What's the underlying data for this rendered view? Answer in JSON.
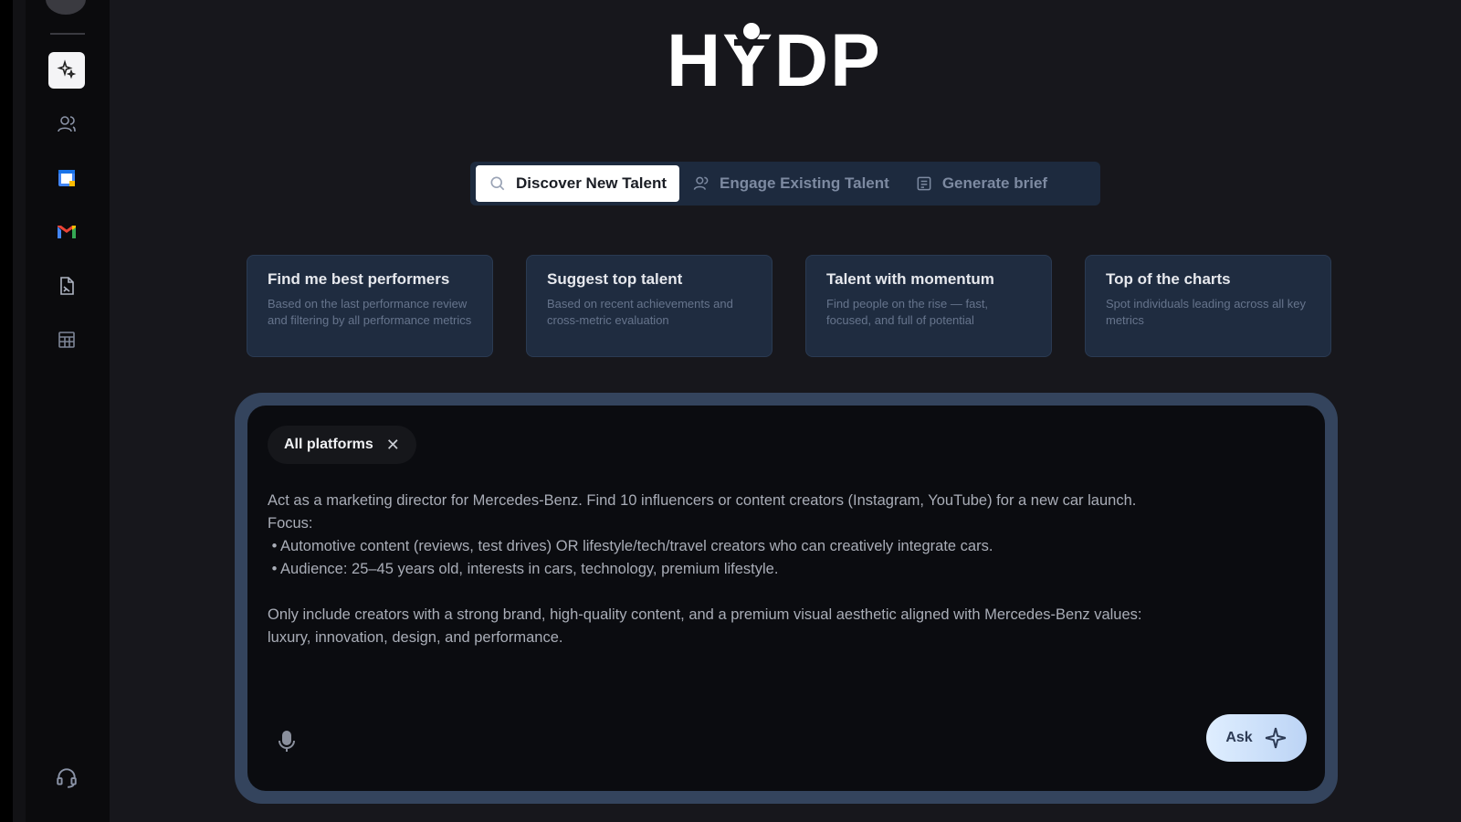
{
  "app": {
    "logo_text": "HYDP"
  },
  "sidebar": {
    "items": [
      {
        "icon": "sparkles-icon",
        "active": true
      },
      {
        "icon": "users-icon",
        "active": false
      },
      {
        "icon": "calendar-icon",
        "active": false
      },
      {
        "icon": "gmail-icon",
        "active": false
      },
      {
        "icon": "document-icon",
        "active": false
      },
      {
        "icon": "table-icon",
        "active": false
      }
    ],
    "bottom_icon": "headset-icon"
  },
  "tabs": [
    {
      "label": "Discover New Talent",
      "icon": "search-icon",
      "active": true
    },
    {
      "label": "Engage Existing Talent",
      "icon": "users-icon",
      "active": false
    },
    {
      "label": "Generate brief",
      "icon": "document-icon",
      "active": false
    }
  ],
  "cards": [
    {
      "title": "Find me best performers",
      "desc": "Based on the last performance review and filtering by all performance metrics"
    },
    {
      "title": "Suggest top talent",
      "desc": "Based on recent achievements and cross-metric evaluation"
    },
    {
      "title": "Talent with momentum",
      "desc": "Find people on the rise — fast, focused, and full of potential"
    },
    {
      "title": "Top of the charts",
      "desc": "Spot individuals leading across all key metrics"
    }
  ],
  "prompt": {
    "chip_label": "All platforms",
    "chip_close": "✕",
    "text": "Act as a marketing director for Mercedes-Benz. Find 10 influencers or content creators (Instagram, YouTube) for a new car launch.\nFocus:\n • Automotive content (reviews, test drives) OR lifestyle/tech/travel creators who can creatively integrate cars.\n • Audience: 25–45 years old, interests in cars, technology, premium lifestyle.\n\nOnly include creators with a strong brand, high-quality content, and a premium visual aesthetic aligned with Mercedes-Benz values:\nluxury, innovation, design, and performance.",
    "ask_label": "Ask"
  },
  "colors": {
    "background": "#17171c",
    "tab_bar": "#1d2a3e",
    "card": "#1f2c40",
    "prompt_border": "#34445d"
  }
}
